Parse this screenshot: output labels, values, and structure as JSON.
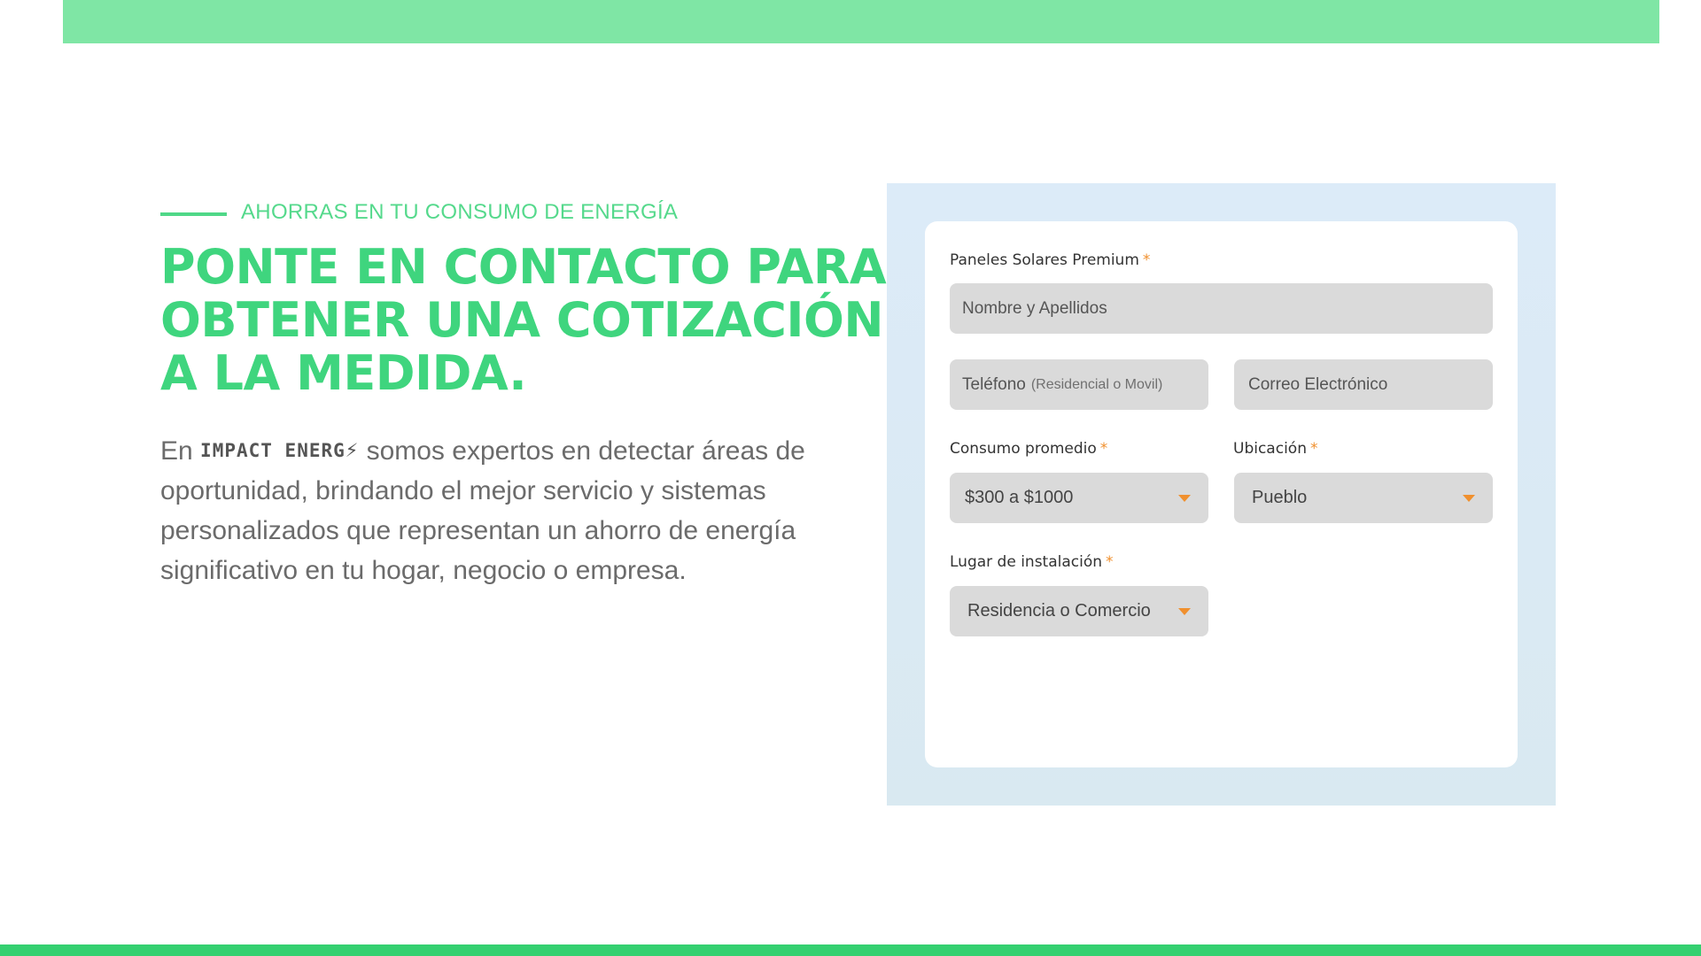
{
  "eyebrow": "AHORRAS EN TU CONSUMO DE ENERGÍA",
  "headline": {
    "line1": "PONTE EN CONTACTO PARA",
    "line2": "OBTENER UNA COTIZACIÓN",
    "line3": "A LA MEDIDA."
  },
  "body": {
    "prefix": "En",
    "brand": "IMPACT ENERG",
    "text": "somos expertos en detectar áreas de oportunidad, brindando el mejor servicio y sistemas personalizados que representan un ahorro de energía significativo en tu hogar, negocio o empresa."
  },
  "form": {
    "product_label": "Paneles Solares Premium",
    "required_mark": "*",
    "name_placeholder": "Nombre y Apellidos",
    "phone_placeholder": "Teléfono",
    "phone_hint": "(Residencial o Movil)",
    "email_placeholder": "Correo Electrónico",
    "consumption_label": "Consumo promedio",
    "consumption_value": "$300 a $1000",
    "location_label": "Ubicación",
    "location_value": "Pueblo",
    "install_label": "Lugar de instalación",
    "install_value": "Residencia o Comercio"
  },
  "colors": {
    "accent_green": "#3fd57e",
    "top_bar": "#7fe6a5",
    "required_orange": "#f0902e",
    "form_frame": "#dcebf8"
  }
}
